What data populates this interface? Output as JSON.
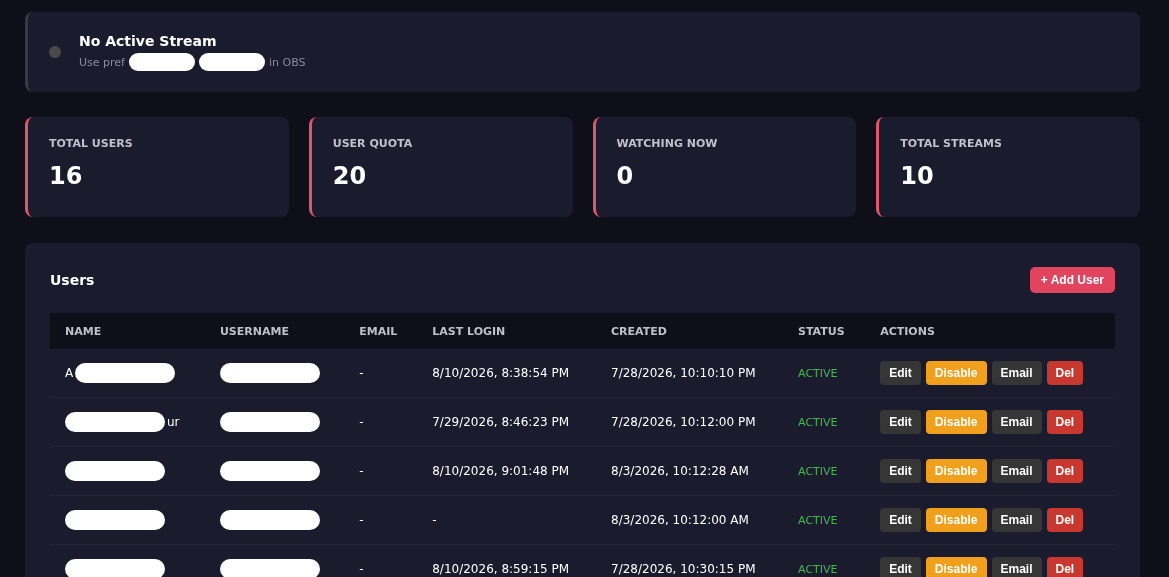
{
  "stream": {
    "live": false,
    "title": "No Active Stream",
    "subtitle": [
      {
        "kind": "text",
        "text": "Use pref"
      },
      {
        "kind": "redaction"
      },
      {
        "kind": "redaction"
      },
      {
        "kind": "text",
        "text": "in OBS"
      }
    ]
  },
  "stats": [
    {
      "label": "TOTAL USERS",
      "value": "16"
    },
    {
      "label": "USER QUOTA",
      "value": "20"
    },
    {
      "label": "WATCHING NOW",
      "value": "0"
    },
    {
      "label": "TOTAL STREAMS",
      "value": "10"
    }
  ],
  "users": {
    "title": "Users",
    "add_button": "+ Add User",
    "columns": [
      "NAME",
      "USERNAME",
      "EMAIL",
      "LAST LOGIN",
      "CREATED",
      "STATUS",
      "ACTIONS"
    ],
    "rows": [
      {
        "name": [
          {
            "kind": "text",
            "text": "A"
          },
          {
            "kind": "redaction"
          }
        ],
        "username": [
          {
            "kind": "redaction"
          }
        ],
        "email": "-",
        "last_login": "8/10/2026, 8:38:54 PM",
        "created": "7/28/2026, 10:10:10 PM",
        "status": "ACTIVE",
        "active": true,
        "actions": [
          "Edit",
          "Disable",
          "Email",
          "Del"
        ]
      },
      {
        "name": [
          {
            "kind": "redaction"
          },
          {
            "kind": "text",
            "text": "ur"
          }
        ],
        "username": [
          {
            "kind": "redaction"
          }
        ],
        "email": "-",
        "last_login": "7/29/2026, 8:46:23 PM",
        "created": "7/28/2026, 10:12:00 PM",
        "status": "ACTIVE",
        "active": true,
        "actions": [
          "Edit",
          "Disable",
          "Email",
          "Del"
        ]
      },
      {
        "name": [
          {
            "kind": "redaction"
          }
        ],
        "username": [
          {
            "kind": "redaction"
          }
        ],
        "email": "-",
        "last_login": "8/10/2026, 9:01:48 PM",
        "created": "8/3/2026, 10:12:28 AM",
        "status": "ACTIVE",
        "active": true,
        "actions": [
          "Edit",
          "Disable",
          "Email",
          "Del"
        ]
      },
      {
        "name": [
          {
            "kind": "redaction"
          }
        ],
        "username": [
          {
            "kind": "redaction"
          }
        ],
        "email": "-",
        "last_login": "-",
        "created": "8/3/2026, 10:12:00 AM",
        "status": "ACTIVE",
        "active": true,
        "actions": [
          "Edit",
          "Disable",
          "Email",
          "Del"
        ]
      },
      {
        "name": [
          {
            "kind": "redaction"
          }
        ],
        "username": [
          {
            "kind": "redaction"
          }
        ],
        "email": "-",
        "last_login": "8/10/2026, 8:59:15 PM",
        "created": "7/28/2026, 10:30:15 PM",
        "status": "ACTIVE",
        "active": true,
        "actions": [
          "Edit",
          "Disable",
          "Email",
          "Del"
        ]
      }
    ]
  }
}
